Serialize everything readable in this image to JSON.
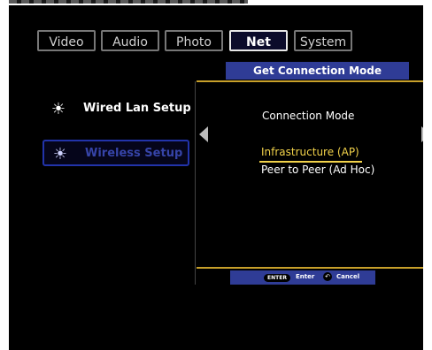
{
  "tabs": [
    {
      "label": "Video",
      "active": false
    },
    {
      "label": "Audio",
      "active": false
    },
    {
      "label": "Photo",
      "active": false
    },
    {
      "label": "Net",
      "active": true
    },
    {
      "label": "System",
      "active": false
    }
  ],
  "submenu": {
    "title": "Get Connection Mode"
  },
  "sidebar": {
    "items": [
      {
        "label": "Wired Lan Setup",
        "selected": false
      },
      {
        "label": "Wireless Setup",
        "selected": true
      }
    ]
  },
  "panel": {
    "title": "Connection Mode",
    "options": [
      {
        "label": "Infrastructure (AP)",
        "highlighted": true
      },
      {
        "label": "Peer to Peer (Ad Hoc)",
        "highlighted": false
      }
    ]
  },
  "footer": {
    "enter_key": "ENTER",
    "enter_label": "Enter",
    "cancel_icon": "return-arrow-icon",
    "cancel_label": "Cancel"
  },
  "colors": {
    "background": "#000000",
    "accent_blue": "#2f3c96",
    "highlight_yellow": "#f3d34a",
    "divider_gold": "#c8a02a"
  }
}
